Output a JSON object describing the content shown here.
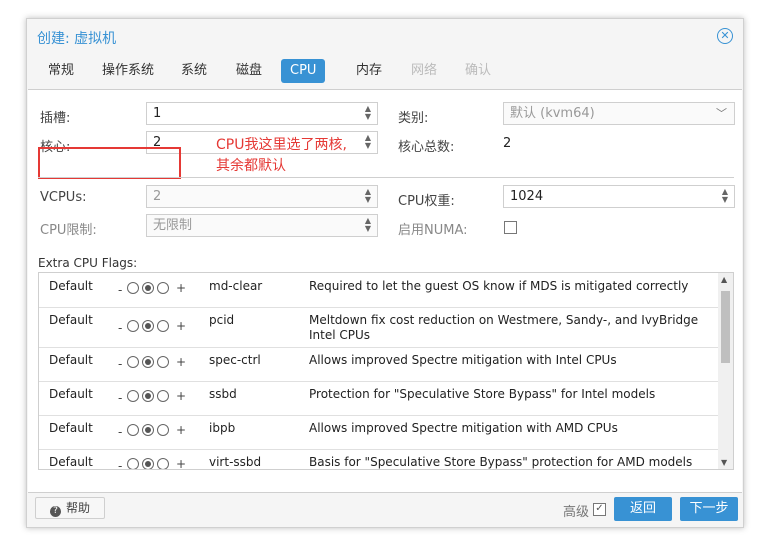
{
  "dialog": {
    "title": "创建: 虚拟机"
  },
  "tabs": [
    {
      "label": "常规",
      "state": "normal"
    },
    {
      "label": "操作系统",
      "state": "normal"
    },
    {
      "label": "系统",
      "state": "normal"
    },
    {
      "label": "磁盘",
      "state": "normal"
    },
    {
      "label": "CPU",
      "state": "active"
    },
    {
      "label": "内存",
      "state": "normal"
    },
    {
      "label": "网络",
      "state": "disabled"
    },
    {
      "label": "确认",
      "state": "disabled"
    }
  ],
  "form": {
    "sockets": {
      "label": "插槽:",
      "value": "1"
    },
    "cores": {
      "label": "核心:",
      "value": "2"
    },
    "type": {
      "label": "类别:",
      "value": "默认 (kvm64)"
    },
    "total_cores": {
      "label": "核心总数:",
      "value": "2"
    },
    "vcpus": {
      "label": "VCPUs:",
      "value": "2"
    },
    "cpu_limit": {
      "label": "CPU限制:",
      "value": "无限制"
    },
    "cpu_units": {
      "label": "CPU权重:",
      "value": "1024"
    },
    "numa": {
      "label": "启用NUMA:",
      "checked": false
    }
  },
  "annotation": {
    "line1": "CPU我这里选了两核,",
    "line2": "其余都默认"
  },
  "flags": {
    "label": "Extra CPU Flags:",
    "rows": [
      {
        "default": "Default",
        "minus": "-",
        "plus": "+",
        "name": "md-clear",
        "desc": "Required to let the guest OS know if MDS is mitigated correctly"
      },
      {
        "default": "Default",
        "minus": "-",
        "plus": "+",
        "name": "pcid",
        "desc": "Meltdown fix cost reduction on Westmere, Sandy-, and IvyBridge Intel CPUs"
      },
      {
        "default": "Default",
        "minus": "-",
        "plus": "+",
        "name": "spec-ctrl",
        "desc": "Allows improved Spectre mitigation with Intel CPUs"
      },
      {
        "default": "Default",
        "minus": "-",
        "plus": "+",
        "name": "ssbd",
        "desc": "Protection for \"Speculative Store Bypass\" for Intel models"
      },
      {
        "default": "Default",
        "minus": "-",
        "plus": "+",
        "name": "ibpb",
        "desc": "Allows improved Spectre mitigation with AMD CPUs"
      },
      {
        "default": "Default",
        "minus": "-",
        "plus": "+",
        "name": "virt-ssbd",
        "desc": "Basis for \"Speculative Store Bypass\" protection for AMD models"
      }
    ]
  },
  "footer": {
    "help_label": "帮助",
    "advanced_label": "高级",
    "advanced_checked": true,
    "back_label": "返回",
    "next_label": "下一步"
  },
  "colors": {
    "accent": "#3892d4",
    "annotation": "#e53935"
  }
}
